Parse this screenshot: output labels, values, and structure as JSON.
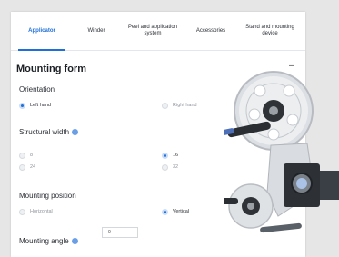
{
  "tabs": [
    {
      "label": "Applicator",
      "active": true
    },
    {
      "label": "Winder",
      "active": false
    },
    {
      "label": "Peel and application system",
      "active": false
    },
    {
      "label": "Accessories",
      "active": false
    },
    {
      "label": "Stand and mounting device",
      "active": false
    }
  ],
  "section": {
    "title": "Mounting form",
    "collapse_symbol": "–"
  },
  "orientation": {
    "label": "Orientation",
    "options": [
      {
        "label": "Left hand",
        "selected": true
      },
      {
        "label": "Right hand",
        "selected": false
      }
    ]
  },
  "structural_width": {
    "label": "Structural width",
    "options": [
      {
        "label": "8",
        "selected": false
      },
      {
        "label": "16",
        "selected": true
      },
      {
        "label": "24",
        "selected": false
      },
      {
        "label": "32",
        "selected": false
      }
    ]
  },
  "mounting_position": {
    "label": "Mounting position",
    "options": [
      {
        "label": "Horizontal",
        "selected": false
      },
      {
        "label": "Vertical",
        "selected": true
      }
    ]
  },
  "mounting_angle": {
    "label": "Mounting angle",
    "value": "0"
  },
  "colors": {
    "accent": "#1e6fd9",
    "info": "#6a9fe6"
  },
  "icons": {
    "info": "info-icon",
    "product": "label-applicator-machine-image"
  }
}
